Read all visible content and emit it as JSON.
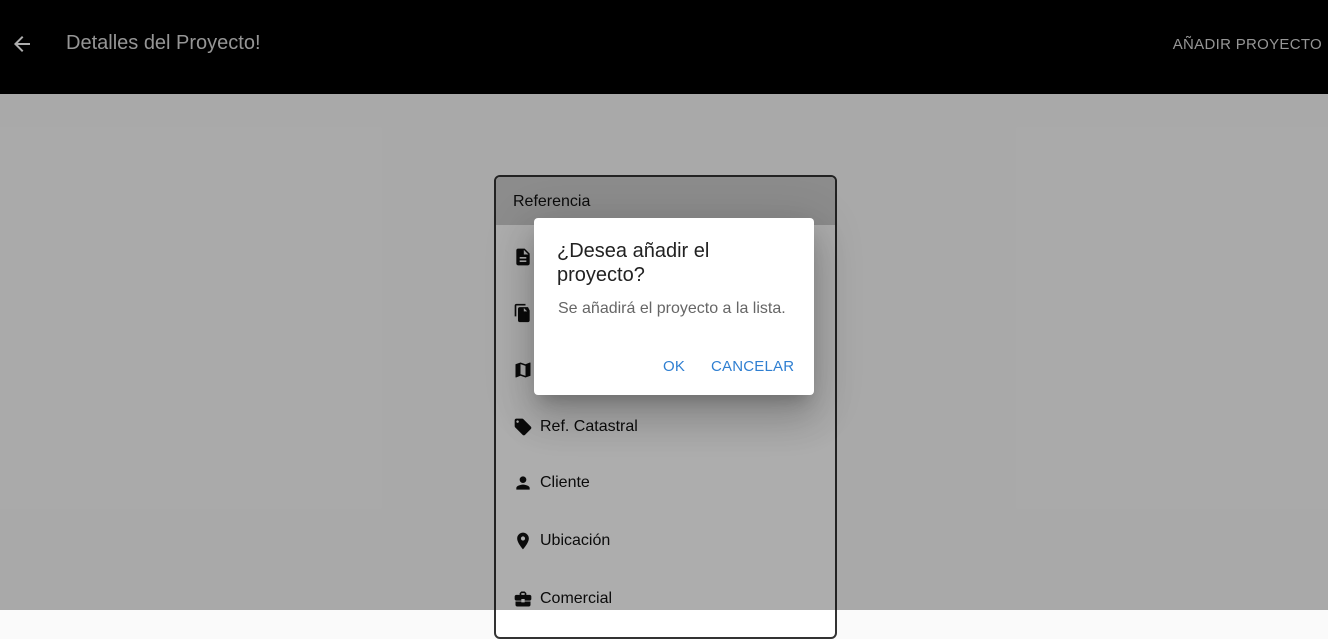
{
  "appbar": {
    "back_icon": "arrow-back-icon",
    "title": "Detalles del Proyecto!",
    "action_label": "AÑADIR PROYECTO"
  },
  "card": {
    "header": "Referencia",
    "items": [
      {
        "icon": "document-icon",
        "label": ""
      },
      {
        "icon": "documents-icon",
        "label": ""
      },
      {
        "icon": "map-icon",
        "label": ""
      },
      {
        "icon": "tag-icon",
        "label": "Ref. Catastral"
      },
      {
        "icon": "person-icon",
        "label": "Cliente"
      },
      {
        "icon": "location-pin-icon",
        "label": "Ubicación"
      },
      {
        "icon": "briefcase-icon",
        "label": "Comercial"
      }
    ]
  },
  "dialog": {
    "title": "¿Desea añadir el proyecto?",
    "message": "Se añadirá el proyecto a la lista.",
    "ok_label": "OK",
    "cancel_label": "CANCELAR"
  },
  "colors": {
    "appbar": "#000000",
    "dialog_button": "#2f7fd1",
    "backdrop": "rgba(0,0,0,0.32)"
  }
}
